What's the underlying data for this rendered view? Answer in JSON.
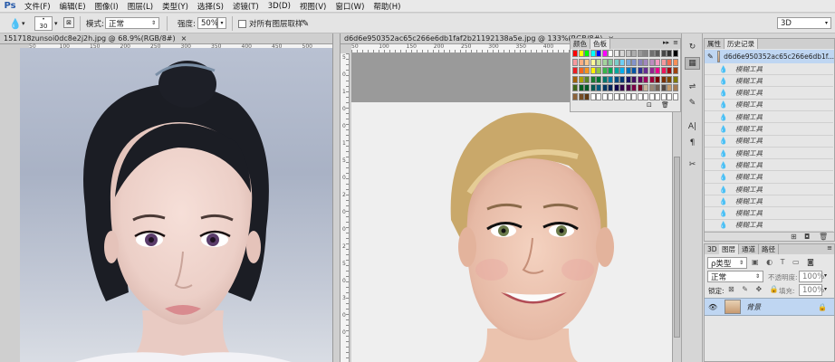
{
  "app": {
    "logo": "Ps"
  },
  "menu": [
    "文件(F)",
    "编辑(E)",
    "图像(I)",
    "图层(L)",
    "类型(Y)",
    "选择(S)",
    "滤镜(T)",
    "3D(D)",
    "视图(V)",
    "窗口(W)",
    "帮助(H)"
  ],
  "options": {
    "brush_size": "30",
    "mode_label": "模式:",
    "mode_value": "正常",
    "strength_label": "强度:",
    "strength_value": "50%",
    "sample_all_label": "对所有图层取样",
    "workspace_value": "3D"
  },
  "toolbox": {
    "icons": [
      "move-icon",
      "marquee-icon",
      "lasso-icon",
      "quick-select-icon",
      "crop-icon",
      "eyedropper-icon",
      "healing-icon",
      "brush-icon",
      "stamp-icon",
      "history-brush-icon",
      "eraser-icon",
      "gradient-icon",
      "blur-icon",
      "dodge-icon",
      "pen-icon",
      "type-icon",
      "path-select-icon",
      "shape-icon",
      "hand-icon",
      "zoom-icon",
      "swap-colors-icon"
    ],
    "glyphs": [
      "✥",
      "⬚",
      "ʘ",
      "✎",
      "⌗",
      "⁄",
      "✚",
      "✏",
      "♣",
      "↺",
      "◫",
      "▤",
      "💧",
      "●",
      "✒",
      "T",
      "↖",
      "▭",
      "✋",
      "🔍",
      "⇆"
    ],
    "active_index": 12
  },
  "doc1": {
    "title": "151718zunsoi0dc8e2j2h.jpg @ 68.9%(RGB/8#)",
    "close": "×",
    "hruler": [
      "50",
      "100",
      "150",
      "200",
      "250",
      "300",
      "350",
      "400",
      "450",
      "500"
    ],
    "vruler": [
      "5",
      "1",
      "0",
      "0",
      "1",
      "5",
      "0",
      "2",
      "0",
      "0",
      "2",
      "5",
      "0",
      "3",
      "0"
    ]
  },
  "doc2": {
    "title": "d6d6e950352ac65c266e6db1faf2b21192138a5e.jpg @ 133%(RGB/8#)",
    "close": "×",
    "hruler": [
      "50",
      "100",
      "150",
      "200",
      "250",
      "300",
      "350",
      "400"
    ],
    "vruler": [
      "5",
      "0",
      "1",
      "0",
      "0",
      "1",
      "5",
      "0",
      "2",
      "0",
      "0",
      "2",
      "5",
      "0",
      "3",
      "0",
      "0"
    ]
  },
  "swatches": {
    "tab1": "颜色",
    "tab2": "色板",
    "colors": [
      [
        "#ff0000",
        "#ffff00",
        "#00ff00",
        "#00ffff",
        "#0000ff",
        "#ff00ff",
        "#ffffff",
        "#ebebeb",
        "#d6d6d6",
        "#c2c2c2",
        "#adadad",
        "#999999",
        "#858585",
        "#707070",
        "#5c5c5c",
        "#474747",
        "#333333",
        "#000000"
      ],
      [
        "#f6989d",
        "#f9ad81",
        "#fdc68a",
        "#fff79a",
        "#c4df9b",
        "#a3d39c",
        "#82ca9d",
        "#7accc8",
        "#6dcff6",
        "#7da7d9",
        "#8393ca",
        "#8781bd",
        "#a187be",
        "#bd8cbf",
        "#f49ac2",
        "#f5989d",
        "#f26c4f",
        "#f68e56"
      ],
      [
        "#ed1c24",
        "#f26522",
        "#f7941d",
        "#fff200",
        "#8dc63f",
        "#39b54a",
        "#00a651",
        "#00a99d",
        "#00aeef",
        "#0072bc",
        "#0054a6",
        "#2e3192",
        "#662d91",
        "#92278f",
        "#ec008c",
        "#ed145b",
        "#9e0b0f",
        "#a0410d"
      ],
      [
        "#a36209",
        "#aba000",
        "#598527",
        "#197b30",
        "#007236",
        "#00746b",
        "#0076a3",
        "#004b80",
        "#003471",
        "#1b1464",
        "#440e62",
        "#630460",
        "#9e005d",
        "#9e0039",
        "#790000",
        "#7b2e00",
        "#7d4900",
        "#827b00"
      ],
      [
        "#406618",
        "#005e20",
        "#005826",
        "#005952",
        "#005b7f",
        "#003663",
        "#002157",
        "#0d004c",
        "#32004b",
        "#4b0049",
        "#7b0046",
        "#7a0026",
        "#c7b299",
        "#998675",
        "#736357",
        "#534741",
        "#c69c6d",
        "#a67c52"
      ],
      [
        "#8c6239",
        "#754c24",
        "#603913",
        "#ffffff",
        "#ffffff",
        "#ffffff",
        "#ffffff",
        "#ffffff",
        "#ffffff",
        "#ffffff",
        "#ffffff",
        "#ffffff",
        "#ffffff",
        "#ffffff",
        "#ffffff",
        "#ffffff",
        "#ffffff",
        "#ffffff"
      ]
    ]
  },
  "side_icons": [
    "history-panel-icon",
    "swatches-panel-icon",
    "adjust-icon",
    "brush-preset-icon",
    "character-icon",
    "paragraph-icon",
    "tools-preset-icon"
  ],
  "side_glyphs": [
    "↻",
    "▦",
    "⇌",
    "✎",
    "A|",
    "¶",
    "✂"
  ],
  "history": {
    "tab1": "属性",
    "tab2": "历史记录",
    "snapshot_name": "d6d6e950352ac65c266e6db1f...",
    "step_label": "模糊工具",
    "steps": [
      "模糊工具",
      "模糊工具",
      "模糊工具",
      "模糊工具",
      "模糊工具",
      "模糊工具",
      "模糊工具",
      "模糊工具",
      "模糊工具",
      "模糊工具",
      "模糊工具",
      "模糊工具",
      "模糊工具",
      "模糊工具"
    ]
  },
  "layers": {
    "tab1": "3D",
    "tab2": "图层",
    "tab3": "通道",
    "tab4": "路径",
    "filter_label": "ρ类型",
    "blend_mode": "正常",
    "opacity_label": "不透明度:",
    "opacity_value": "100%",
    "lock_label": "锁定:",
    "fill_label": "填充:",
    "fill_value": "100%",
    "layer_name": "背景"
  }
}
